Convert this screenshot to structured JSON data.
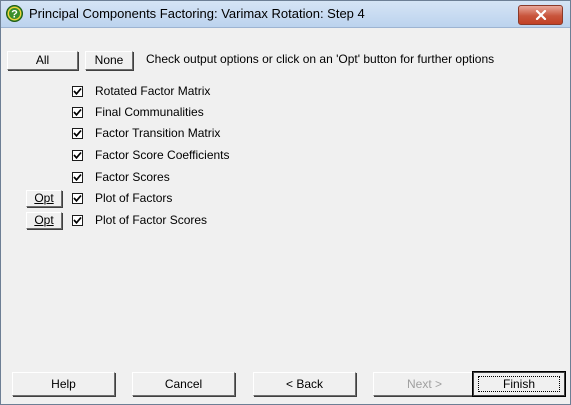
{
  "window": {
    "title": "Principal Components Factoring: Varimax Rotation: Step 4",
    "close_icon": "close-icon",
    "help_icon": "question-icon"
  },
  "toolbar": {
    "all_label": "All",
    "none_label": "None",
    "hint": "Check output options or click on an 'Opt' button for further options"
  },
  "options": [
    {
      "label": "Rotated Factor Matrix",
      "checked": true,
      "has_opt": false
    },
    {
      "label": "Final Communalities",
      "checked": true,
      "has_opt": false
    },
    {
      "label": "Factor Transition Matrix",
      "checked": true,
      "has_opt": false
    },
    {
      "label": "Factor Score Coefficients",
      "checked": true,
      "has_opt": false
    },
    {
      "label": "Factor Scores",
      "checked": true,
      "has_opt": false
    },
    {
      "label": "Plot of Factors",
      "checked": true,
      "has_opt": true
    },
    {
      "label": "Plot of Factor Scores",
      "checked": true,
      "has_opt": true
    }
  ],
  "opt_button_label": "Opt",
  "footer": {
    "help_label": "Help",
    "cancel_label": "Cancel",
    "back_label": "< Back",
    "next_label": "Next >",
    "finish_label": "Finish",
    "next_enabled": false
  },
  "colors": {
    "window_bg": "#f0f0f0",
    "title_gradient": "#bcd3ee",
    "close_red": "#c24126",
    "help_icon_green": "#3b8f2a",
    "disabled_text": "#a0a0a0"
  }
}
